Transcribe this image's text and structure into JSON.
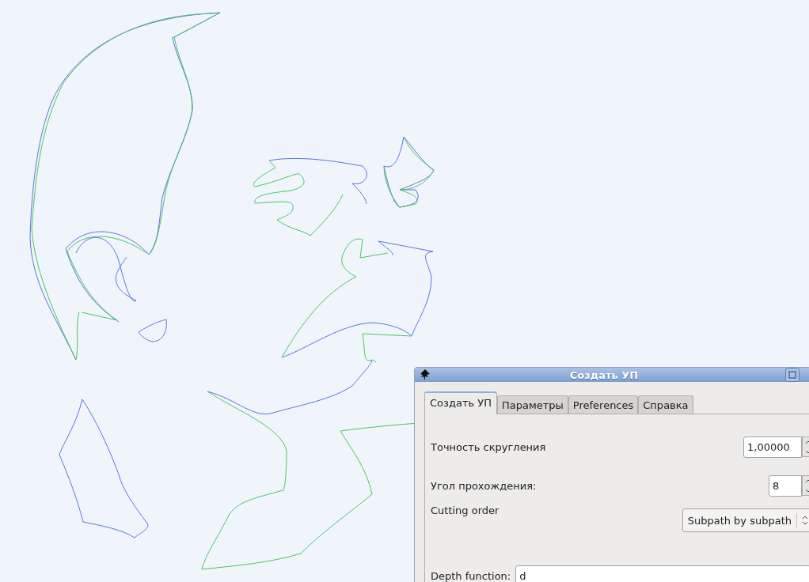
{
  "dialog": {
    "title": "Создать УП"
  },
  "tabs": [
    {
      "label": "Создать УП",
      "selected": true
    },
    {
      "label": "Параметры",
      "selected": false
    },
    {
      "label": "Preferences",
      "selected": false
    },
    {
      "label": "Справка",
      "selected": false
    }
  ],
  "fields": [
    {
      "kind": "spin",
      "label": "Точность скругления",
      "value": "1,00000"
    },
    {
      "kind": "spin",
      "label": "Угол прохождения:",
      "value": "8"
    },
    {
      "kind": "select",
      "label": "Cutting order",
      "value": "Subpath by subpath"
    },
    {
      "kind": "text",
      "label": "Depth function:",
      "value": "d"
    }
  ]
}
